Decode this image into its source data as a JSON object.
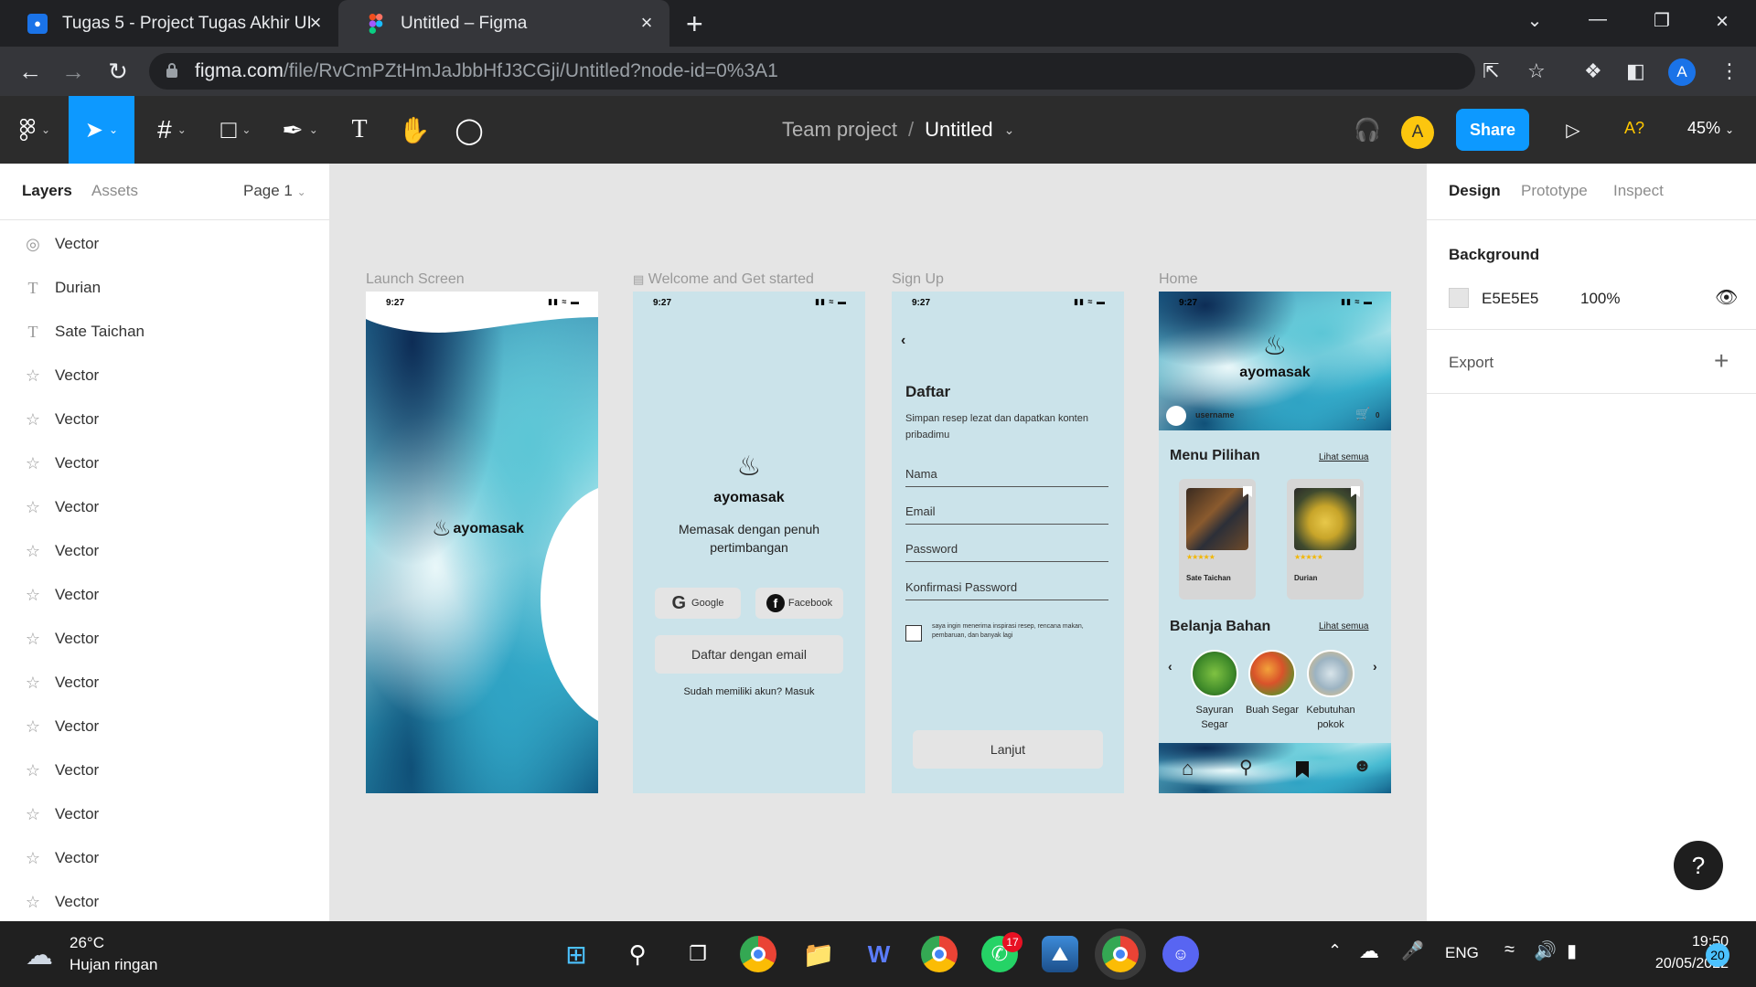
{
  "browser": {
    "tabs": [
      {
        "title": "Tugas 5 - Project Tugas Akhir UI",
        "icon": "person-icon",
        "color": "#1a73e8"
      },
      {
        "title": "Untitled – Figma",
        "icon": "figma-icon",
        "active": true
      }
    ],
    "url_host": "figma.com",
    "url_path": "/file/RvCmPZtHmJaJbbHfJ3CGji/Untitled?node-id=0%3A1",
    "profile_initial": "A"
  },
  "figma_toolbar": {
    "team": "Team project",
    "separator": "/",
    "file_name": "Untitled",
    "share_label": "Share",
    "avatar_initial": "A",
    "missing_fonts": "A?",
    "zoom": "45%"
  },
  "left_panel": {
    "tabs": [
      "Layers",
      "Assets"
    ],
    "page": "Page 1",
    "layers": [
      {
        "name": "Vector",
        "icon": "component-icon"
      },
      {
        "name": "Durian",
        "icon": "text-icon"
      },
      {
        "name": "Sate Taichan",
        "icon": "text-icon"
      },
      {
        "name": "Vector",
        "icon": "star-icon"
      },
      {
        "name": "Vector",
        "icon": "star-icon"
      },
      {
        "name": "Vector",
        "icon": "star-icon"
      },
      {
        "name": "Vector",
        "icon": "star-icon"
      },
      {
        "name": "Vector",
        "icon": "star-icon"
      },
      {
        "name": "Vector",
        "icon": "star-icon"
      },
      {
        "name": "Vector",
        "icon": "star-icon"
      },
      {
        "name": "Vector",
        "icon": "star-icon"
      },
      {
        "name": "Vector",
        "icon": "star-icon"
      },
      {
        "name": "Vector",
        "icon": "star-icon"
      },
      {
        "name": "Vector",
        "icon": "star-icon"
      },
      {
        "name": "Vector",
        "icon": "star-icon"
      },
      {
        "name": "Vector",
        "icon": "star-icon"
      }
    ]
  },
  "canvas": {
    "frames": [
      {
        "label": "Launch Screen"
      },
      {
        "label": "Welcome and Get started"
      },
      {
        "label": "Sign Up"
      },
      {
        "label": "Home"
      }
    ],
    "phone_time": "9:27",
    "launch": {
      "brand": "ayomasak"
    },
    "welcome": {
      "brand": "ayomasak",
      "tagline": "Memasak dengan penuh pertimbangan",
      "google": "Google",
      "facebook": "Facebook",
      "email_btn": "Daftar dengan email",
      "login": "Sudah memiliki akun? Masuk"
    },
    "signup": {
      "title": "Daftar",
      "subtitle": "Simpan resep lezat dan dapatkan konten pribadimu",
      "fields": [
        "Nama",
        "Email",
        "Password",
        "Konfirmasi Password"
      ],
      "consent": "saya ingin menerima inspirasi resep, rencana makan, pembaruan, dan banyak lagi",
      "next": "Lanjut"
    },
    "home": {
      "brand": "ayomasak",
      "username": "username",
      "cart_count": "0",
      "menu_title": "Menu Pilihan",
      "see_all": "Lihat semua",
      "menu_items": [
        "Sate Taichan",
        "Durian"
      ],
      "shop_title": "Belanja Bahan",
      "categories": [
        "Sayuran Segar",
        "Buah Segar",
        "Kebutuhan pokok"
      ]
    }
  },
  "right_panel": {
    "tabs": [
      "Design",
      "Prototype",
      "Inspect"
    ],
    "background_label": "Background",
    "bg_color": "E5E5E5",
    "bg_opacity": "100%",
    "export_label": "Export"
  },
  "help": "?",
  "taskbar": {
    "temp": "26°C",
    "weather": "Hujan ringan",
    "lang": "ENG",
    "time": "19:50",
    "date": "20/05/2022",
    "notif_count": "20",
    "whatsapp_badge": "17"
  }
}
